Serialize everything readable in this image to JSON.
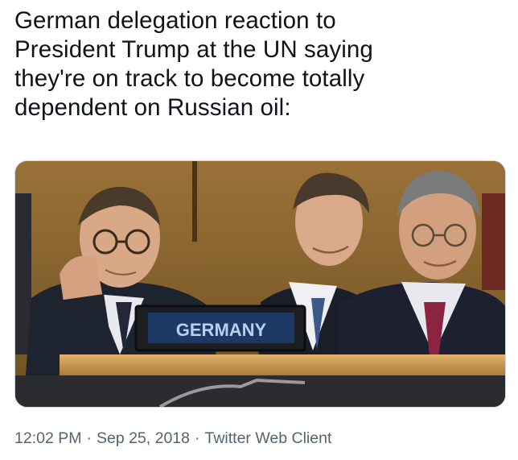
{
  "tweet": {
    "text_lines": [
      "German delegation reaction to",
      "President Trump at the UN saying",
      "they're on track to become totally",
      "dependent on Russian oil:"
    ],
    "media": {
      "nameplate": "GERMANY"
    },
    "time": "12:02 PM",
    "separator": "·",
    "date": "Sep 25, 2018",
    "source": "Twitter Web Client"
  },
  "colors": {
    "text": "#0f1419",
    "meta": "#536471",
    "nameplate_bg": "#1c1e22",
    "nameplate_screen": "#1d3a66",
    "nameplate_text": "#b8cfee",
    "wall": "#8a6632"
  }
}
